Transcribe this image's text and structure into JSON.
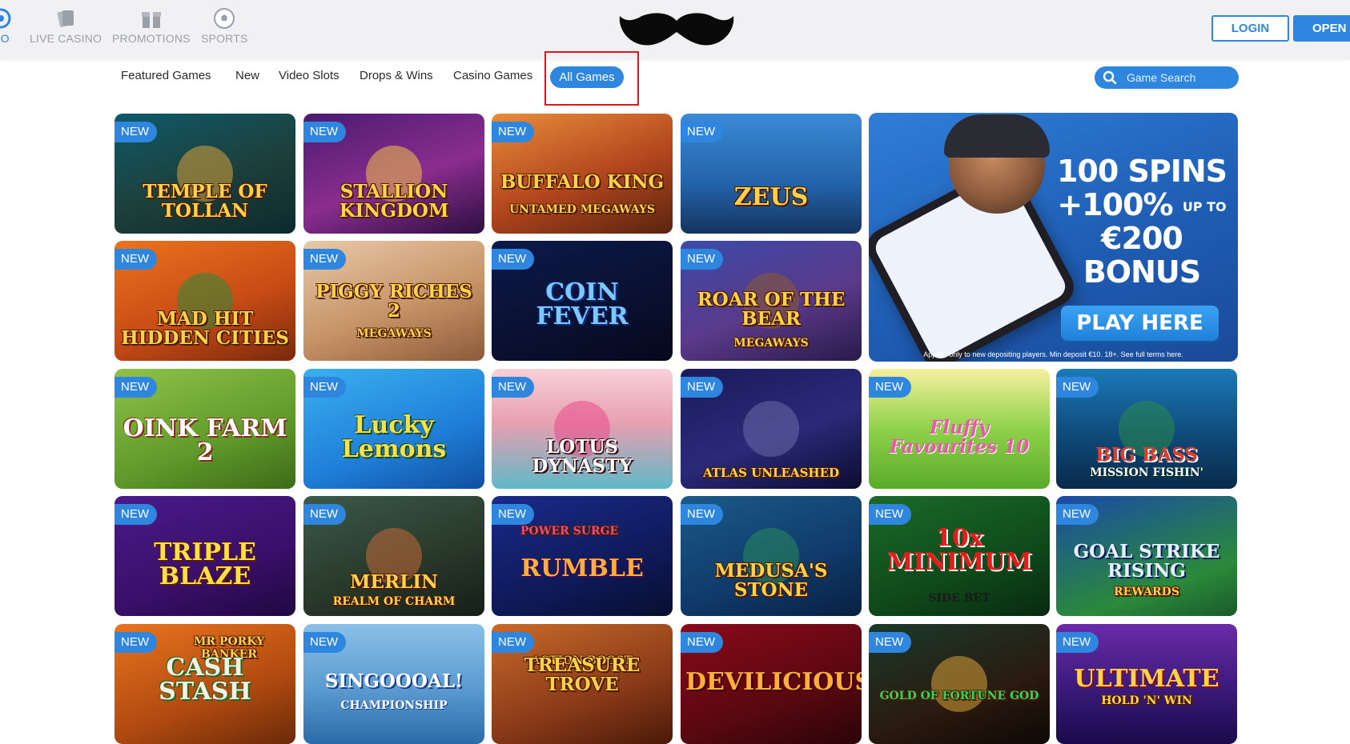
{
  "header": {
    "nav": [
      {
        "label": "NO",
        "icon": "casino-chip-icon"
      },
      {
        "label": "LIVE CASINO",
        "icon": "cards-icon"
      },
      {
        "label": "PROMOTIONS",
        "icon": "gift-icon"
      },
      {
        "label": "SPORTS",
        "icon": "soccer-ball-icon"
      }
    ],
    "logo": "mustache-logo",
    "login_label": "LOGIN",
    "open_label": "OPEN A"
  },
  "tabs": {
    "items": [
      "Featured Games",
      "New",
      "Video Slots",
      "Drops & Wins",
      "Casino Games"
    ],
    "active": "All Games"
  },
  "search": {
    "placeholder": "Game Search"
  },
  "badge_label": "NEW",
  "games": [
    {
      "title": "TEMPLE OF TOLLAN",
      "subtitle": ""
    },
    {
      "title": "STALLION KINGDOM",
      "subtitle": ""
    },
    {
      "title": "BUFFALO KING",
      "subtitle": "UNTAMED MEGAWAYS"
    },
    {
      "title": "ZEUS",
      "subtitle": ""
    },
    {
      "title": "MAD HIT HIDDEN CITIES",
      "subtitle": ""
    },
    {
      "title": "PIGGY RICHES 2",
      "subtitle": "MEGAWAYS"
    },
    {
      "title": "COIN FEVER",
      "subtitle": ""
    },
    {
      "title": "ROAR OF THE BEAR",
      "subtitle": "MEGAWAYS"
    },
    {
      "title": "OINK FARM 2",
      "subtitle": ""
    },
    {
      "title": "Lucky Lemons",
      "subtitle": ""
    },
    {
      "title": "LOTUS DYNASTY",
      "subtitle": ""
    },
    {
      "title": "ATLAS UNLEASHED",
      "subtitle": ""
    },
    {
      "title": "Fluffy Favourites 10",
      "subtitle": ""
    },
    {
      "title": "BIG BASS",
      "subtitle": "MISSION FISHIN'"
    },
    {
      "title": "TRIPLE BLAZE",
      "subtitle": ""
    },
    {
      "title": "MERLIN",
      "subtitle": "REALM OF CHARM"
    },
    {
      "title": "RUMBLE",
      "subtitle": "POWER SURGE"
    },
    {
      "title": "MEDUSA'S STONE",
      "subtitle": ""
    },
    {
      "title": "10x MINIMUM",
      "subtitle": "SIDE BET"
    },
    {
      "title": "GOAL STRIKE RISING",
      "subtitle": "REWARDS"
    },
    {
      "title": "CASH STASH",
      "subtitle": "MR PORKY BANKER"
    },
    {
      "title": "SINGOOOAL!",
      "subtitle": "CHAMPIONSHIP"
    },
    {
      "title": "TREASURE TROVE",
      "subtitle": "ACTION BOOST"
    },
    {
      "title": "DEVILICIOUS",
      "subtitle": ""
    },
    {
      "title": "GOLD OF FORTUNE GOD",
      "subtitle": ""
    },
    {
      "title": "ULTIMATE",
      "subtitle": "HOLD 'N' WIN"
    }
  ],
  "promo": {
    "line1": "100 SPINS",
    "line2": "+100%",
    "upto": "UP TO",
    "line3": "€200",
    "line4": "BONUS",
    "cta": "PLAY HERE",
    "terms": "Applies only to new depositing players. Min deposit €10. 18+. See full terms here."
  },
  "colors": {
    "accent": "#2e86de",
    "highlight": "#e0161c"
  }
}
